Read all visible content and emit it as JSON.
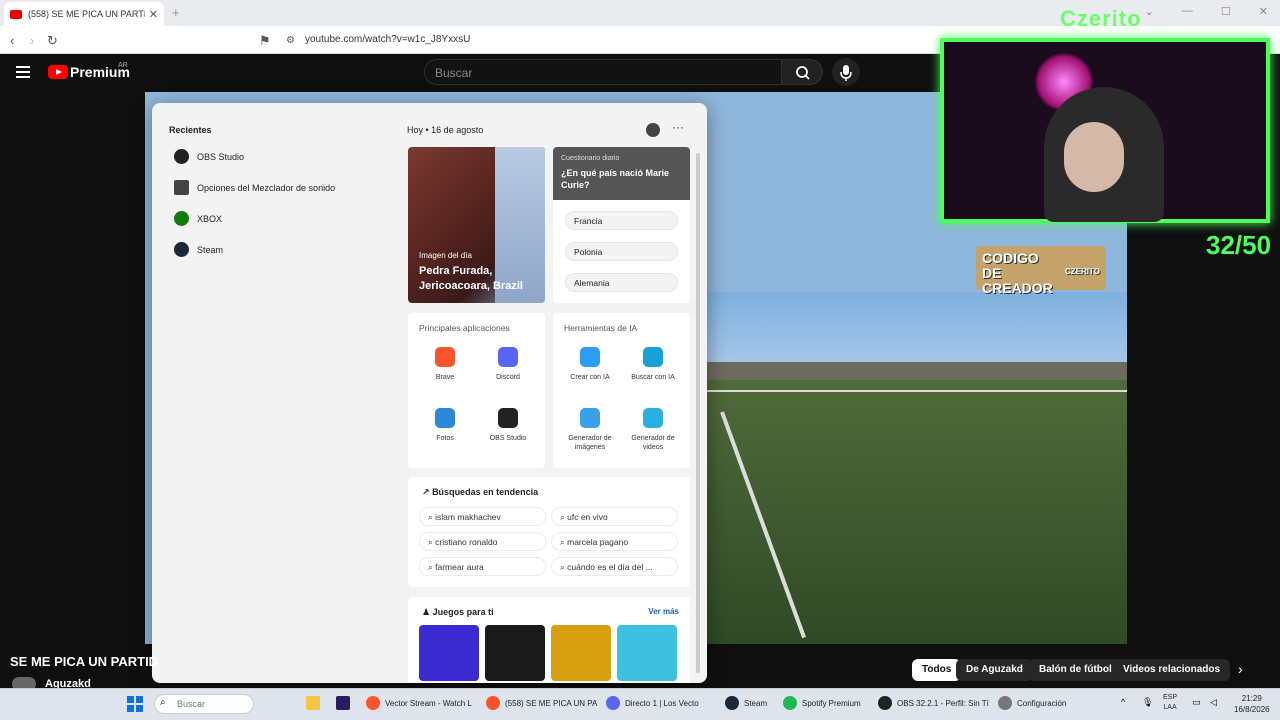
{
  "browser": {
    "tab_title": "(558) SE ME PICA UN PARTIDO V...",
    "url": "youtube.com/watch?v=w1c_J8YxxsU"
  },
  "youtube": {
    "brand": "Premium",
    "region": "AR",
    "search_placeholder": "Buscar",
    "video_title": "SE ME PICA UN PARTID",
    "channel": "Aguzakd",
    "chips": [
      "Todos",
      "De Aguzakd",
      "Balón de fútbol",
      "Videos relacionados"
    ]
  },
  "overlay": {
    "streamer": "Czerito",
    "counter": "32/50",
    "creator_code": "CODIGO DE CREADOR",
    "creator_tag": "CZERITO"
  },
  "start_panel": {
    "recentes_label": "Recientes",
    "recent_items": [
      {
        "label": "OBS Studio",
        "icon": "obs-icon",
        "color": "#222222"
      },
      {
        "label": "Opciones del Mezclador de sonido",
        "icon": "speaker-icon",
        "color": "#444444"
      },
      {
        "label": "XBOX",
        "icon": "xbox-icon",
        "color": "#107c10"
      },
      {
        "label": "Steam",
        "icon": "steam-icon",
        "color": "#1b2838"
      }
    ],
    "today": "Hoy",
    "date": "16 de agosto",
    "image_of_day": {
      "label": "Imagen del día",
      "title": "Pedra Furada, Jericoacoara, Brazil"
    },
    "quiz": {
      "kicker": "Cuestionario diario",
      "question": "¿En qué país nació Marie Curie?",
      "options": [
        "Francia",
        "Polonia",
        "Alemania"
      ]
    },
    "top_apps": {
      "title": "Principales aplicaciones",
      "items": [
        {
          "label": "Brave",
          "icon": "brave-icon",
          "color": "#fb542b"
        },
        {
          "label": "Discord",
          "icon": "discord-icon",
          "color": "#5865f2"
        },
        {
          "label": "Fotos",
          "icon": "photos-icon",
          "color": "#2b88d8"
        },
        {
          "label": "OBS Studio",
          "icon": "obs-icon",
          "color": "#222222"
        }
      ]
    },
    "ai_tools": {
      "title": "Herramientas de IA",
      "items": [
        {
          "label": "Crear con IA",
          "icon": "create-ai-icon",
          "color": "#2a9df4"
        },
        {
          "label": "Buscar con IA",
          "icon": "search-ai-icon",
          "color": "#18a0d8"
        },
        {
          "label": "Generador de imágenes",
          "icon": "image-gen-icon",
          "color": "#3aa0e8"
        },
        {
          "label": "Generador de videos",
          "icon": "video-gen-icon",
          "color": "#2ab0e0"
        }
      ]
    },
    "trending": {
      "title": "Búsquedas en tendencia",
      "items": [
        "islam makhachev",
        "ufc en vivo",
        "cristiano ronaldo",
        "marcela pagano",
        "farmear aura",
        "cuándo es el día del ..."
      ]
    },
    "games": {
      "title": "Juegos para ti",
      "more": "Ver más",
      "colors": [
        "#3a2ad0",
        "#1a1a1a",
        "#d8a010",
        "#40c0e0"
      ]
    }
  },
  "taskbar": {
    "search_placeholder": "Buscar",
    "items": [
      {
        "label": "Vector Stream - Watch L",
        "icon": "brave-icon",
        "color": "#fb542b"
      },
      {
        "label": "(558) SE ME PICA UN PA",
        "icon": "brave-icon",
        "color": "#fb542b"
      },
      {
        "label": "Directo 1 | Los Vecto",
        "icon": "discord-icon",
        "color": "#5865f2"
      },
      {
        "label": "Steam",
        "icon": "steam-icon",
        "color": "#1b2838"
      },
      {
        "label": "Spotify Premium",
        "icon": "spotify-icon",
        "color": "#1db954"
      },
      {
        "label": "OBS 32.2.1 - Perfil: Sin Tí",
        "icon": "obs-icon",
        "color": "#222222"
      },
      {
        "label": "Configuración",
        "icon": "gear-icon",
        "color": "#777777"
      }
    ],
    "lang_line1": "ESP",
    "lang_line2": "LAA",
    "time": "21:29",
    "date": "16/8/2026"
  }
}
